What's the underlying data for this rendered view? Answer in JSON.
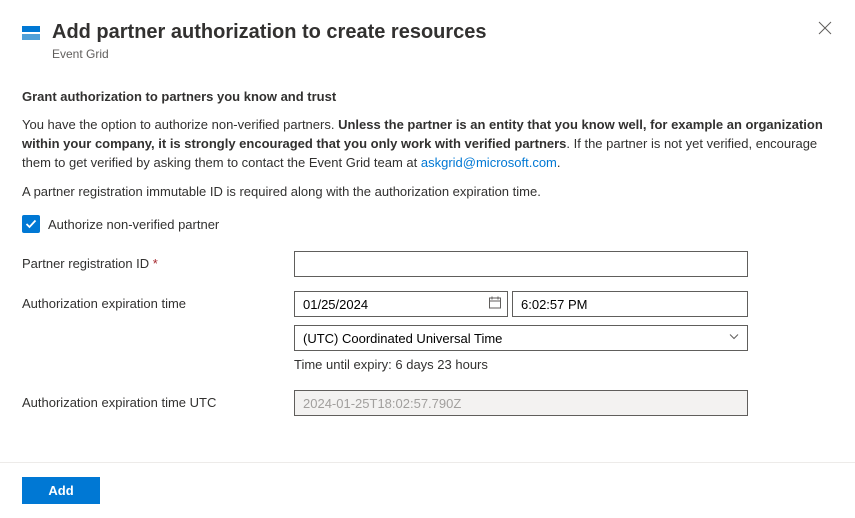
{
  "header": {
    "title": "Add partner authorization to create resources",
    "subtitle": "Event Grid"
  },
  "section_title": "Grant authorization to partners you know and trust",
  "description": {
    "pre": "You have the option to authorize non-verified partners. ",
    "bold": "Unless the partner is an entity that you know well, for example an organization within your company, it is strongly encouraged that you only work with verified partners",
    "post": ". If the partner is not yet verified, encourage them to get verified by asking them to contact the Event Grid team at ",
    "link": "askgrid@microsoft.com",
    "tail": "."
  },
  "note": "A partner registration immutable ID is required along with the authorization expiration time.",
  "checkbox_label": "Authorize non-verified partner",
  "form": {
    "partner_id_label": "Partner registration ID",
    "partner_id_value": "",
    "expiration_label": "Authorization expiration time",
    "date_value": "01/25/2024",
    "time_value": "6:02:57 PM",
    "timezone_value": "(UTC) Coordinated Universal Time",
    "time_until": "Time until expiry: 6 days 23 hours",
    "expiration_utc_label": "Authorization expiration time UTC",
    "expiration_utc_value": "2024-01-25T18:02:57.790Z"
  },
  "footer": {
    "add_label": "Add"
  }
}
